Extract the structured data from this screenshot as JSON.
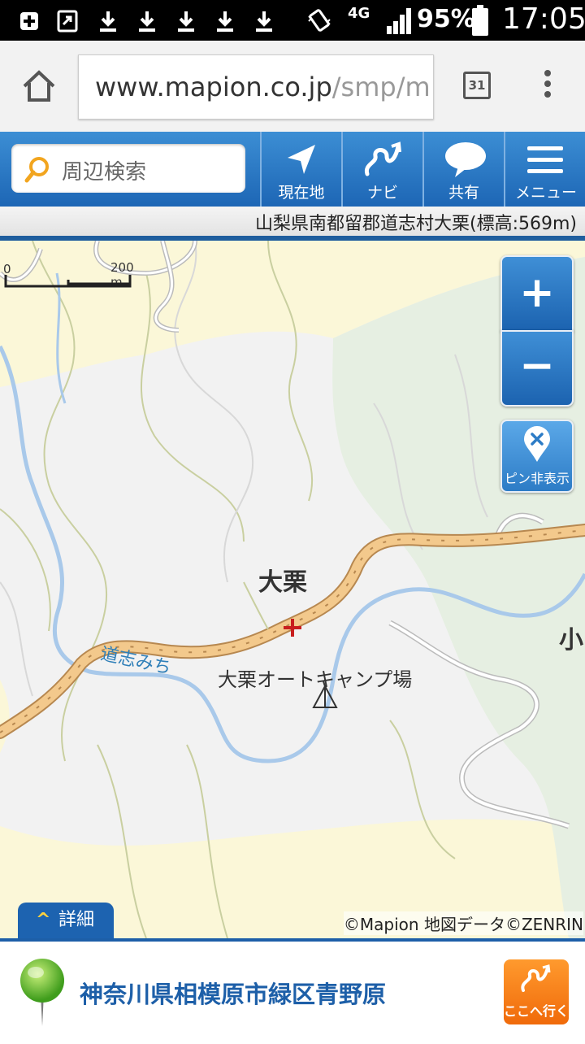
{
  "status_bar": {
    "battery_percent": "95%",
    "time": "17:05",
    "network": "4G",
    "icons": [
      "plus-icon",
      "share-icon",
      "download-icon",
      "download-icon",
      "download-icon",
      "download-icon",
      "download-icon",
      "vibrate-icon",
      "signal-icon",
      "battery-icon"
    ]
  },
  "browser": {
    "url_host": "www.mapion.co.jp",
    "url_path": "/smp/m",
    "tab_count": "31",
    "icons": {
      "home": "home-icon",
      "menu": "more-vert-icon"
    }
  },
  "toolbar": {
    "search_label": "周辺検索",
    "buttons": [
      {
        "label": "現在地",
        "icon": "location-arrow-icon"
      },
      {
        "label": "ナビ",
        "icon": "route-icon"
      },
      {
        "label": "共有",
        "icon": "speech-bubble-icon"
      },
      {
        "label": "メニュー",
        "icon": "hamburger-icon"
      }
    ]
  },
  "address": {
    "text": "山梨県南都留郡道志村大栗(標高:569m)"
  },
  "map": {
    "scale": {
      "zero": "0",
      "distance": "200 m"
    },
    "zoom_in": "+",
    "zoom_out": "−",
    "pin_toggle_label": "ピン非表示",
    "labels": {
      "town": "大栗",
      "road": "道志みち",
      "campsite": "大栗オートキャンプ場",
      "edge": "小"
    },
    "detail_tab_label": "詳細",
    "copyright": "©Mapion 地図データ©ZENRIN",
    "colors": {
      "residential": "#fbf7d8",
      "forest": "#e6efe2",
      "river": "#a9c9ea",
      "main_road": "#f3c98c",
      "accent": "#1d63b0"
    }
  },
  "destination": {
    "place": "神奈川県相模原市緑区青野原",
    "go_label": "ここへ行く"
  }
}
